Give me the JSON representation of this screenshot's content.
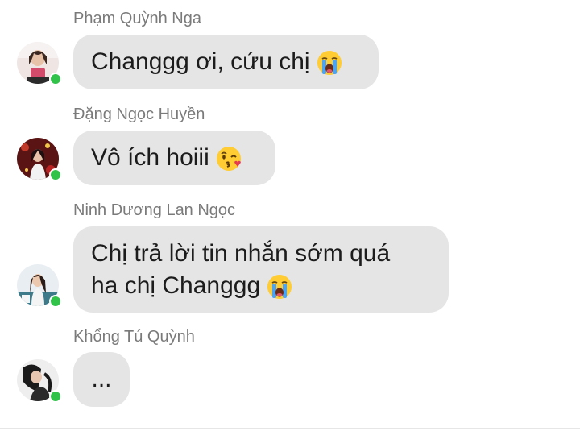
{
  "messages": [
    {
      "sender": "Phạm Quỳnh Nga",
      "lines": [
        "Changgg ơi, cứu chị"
      ],
      "emoji": "loudly-crying-face",
      "online": true
    },
    {
      "sender": "Đặng Ngọc Huyền",
      "lines": [
        "Vô ích hoiii"
      ],
      "emoji": "face-blowing-kiss",
      "online": true
    },
    {
      "sender": "Ninh Dương Lan Ngọc",
      "lines": [
        "Chị trả lời tin nhắn sớm quá",
        "ha chị Changgg"
      ],
      "emoji": "loudly-crying-face",
      "online": true
    },
    {
      "sender": "Khổng Tú Quỳnh",
      "lines": [
        "..."
      ],
      "emoji": "",
      "online": true
    }
  ],
  "colors": {
    "bubble": "#e5e5e5",
    "sender_text": "#7a7a7a",
    "online_dot": "#31c24a"
  }
}
